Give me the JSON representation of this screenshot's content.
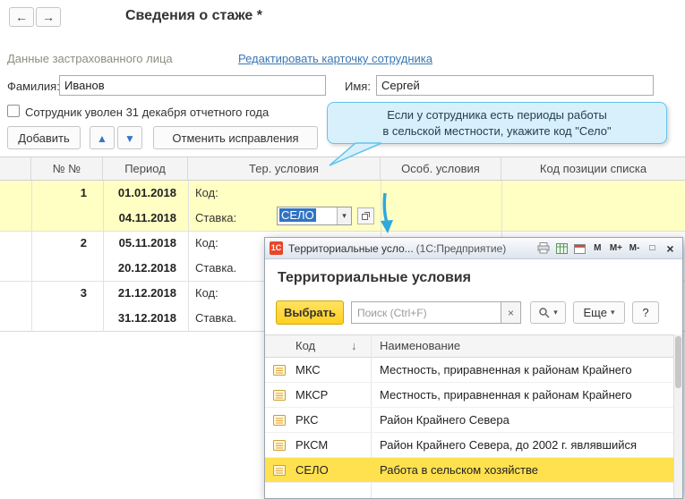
{
  "page": {
    "title": "Сведения о стаже *",
    "section_label": "Данные застрахованного лица",
    "edit_link": "Редактировать карточку сотрудника"
  },
  "nav": {
    "back_icon": "←",
    "forward_icon": "→"
  },
  "form": {
    "lastname_label": "Фамилия:",
    "lastname_value": "Иванов",
    "firstname_label": "Имя:",
    "firstname_value": "Сергей",
    "dismissed_checkbox_label": "Сотрудник уволен 31 декабря отчетного года"
  },
  "toolbar": {
    "add_label": "Добавить",
    "move_up_icon": "▲",
    "move_down_icon": "▼",
    "undo_label": "Отменить исправления"
  },
  "callout": {
    "line1": "Если у сотрудника есть периоды работы",
    "line2": "в сельской местности, укажите код \"Село\""
  },
  "grid": {
    "headers": {
      "num": "№ №",
      "period": "Период",
      "territorial": "Тер. условия",
      "special": "Особ. условия",
      "position": "Код позиции списка"
    },
    "rows": [
      {
        "num": "1",
        "date_start": "01.01.2018",
        "date_end": "04.11.2018",
        "code_label": "Код:",
        "code_value": "СЕЛО",
        "rate_label": "Ставка:"
      },
      {
        "num": "2",
        "date_start": "05.11.2018",
        "date_end": "20.12.2018",
        "code_label": "Код:",
        "rate_label": "Ставка."
      },
      {
        "num": "3",
        "date_start": "21.12.2018",
        "date_end": "31.12.2018",
        "code_label": "Код:",
        "rate_label": "Ставка."
      }
    ],
    "dropdown_icon": "▾"
  },
  "dialog": {
    "titlebar": {
      "logo": "1С",
      "title": "Территориальные усло...",
      "app": "(1С:Предприятие)",
      "scale_buttons": [
        "М",
        "М+",
        "М-"
      ],
      "maximize_icon": "□",
      "close_icon": "×"
    },
    "heading": "Территориальные условия",
    "select_button": "Выбрать",
    "search_placeholder": "Поиск (Ctrl+F)",
    "clear_icon": "×",
    "more_button": "Еще",
    "dropdown_icon": "▾",
    "help_button": "?",
    "table": {
      "code_header": "Код",
      "sort_icon": "↓",
      "name_header": "Наименование",
      "rows": [
        {
          "code": "МКС",
          "name": "Местность, приравненная к районам Крайнего"
        },
        {
          "code": "МКСР",
          "name": "Местность, приравненная к районам Крайнего"
        },
        {
          "code": "РКС",
          "name": "Район Крайнего Севера"
        },
        {
          "code": "РКСМ",
          "name": "Район Крайнего Севера, до 2002 г. являвшийся"
        },
        {
          "code": "СЕЛО",
          "name": "Работа в сельском хозяйстве"
        }
      ]
    }
  }
}
